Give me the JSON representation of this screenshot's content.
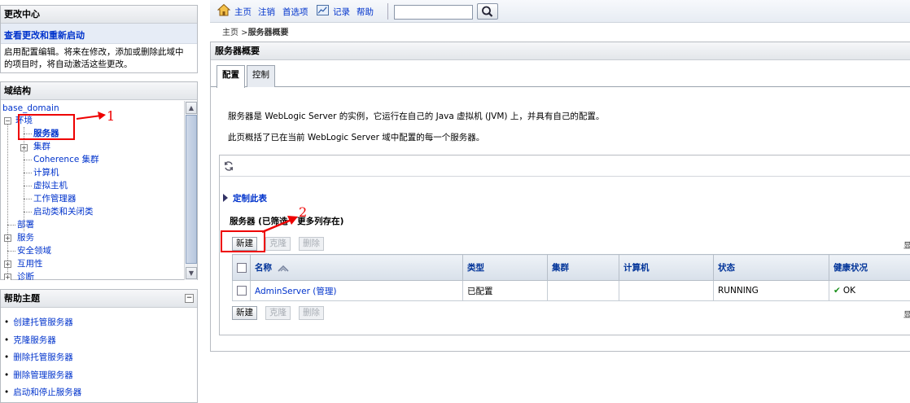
{
  "change_center": {
    "title": "更改中心",
    "link": "查看更改和重新启动",
    "desc_line1": "启用配置编辑。将来在修改，添加或删除此域中",
    "desc_line2": "的项目时，将自动激活这些更改。"
  },
  "domain_structure": {
    "title": "域结构",
    "root": "base_domain",
    "items": {
      "environment": "环境",
      "servers": "服务器",
      "clusters": "集群",
      "coherence": "Coherence 集群",
      "machines": "计算机",
      "virtual_hosts": "虚拟主机",
      "work_managers": "工作管理器",
      "startup_shutdown": "启动类和关闭类",
      "deployments": "部署",
      "services": "服务",
      "security_realms": "安全领域",
      "interoperability": "互用性",
      "diagnostics": "诊断"
    }
  },
  "help_topics": {
    "title": "帮助主题",
    "items": [
      "创建托管服务器",
      "克隆服务器",
      "删除托管服务器",
      "删除管理服务器",
      "启动和停止服务器"
    ]
  },
  "toolbar": {
    "home": "主页",
    "logout": "注销",
    "preferences": "首选项",
    "record": "记录",
    "help": "帮助",
    "search_value": ""
  },
  "breadcrumb": {
    "home": "主页",
    "sep": " >",
    "current": "服务器概要"
  },
  "panel": {
    "title": "服务器概要",
    "tabs": [
      "配置",
      "控制"
    ],
    "desc1": "服务器是 WebLogic Server 的实例，它运行在自己的 Java 虚拟机 (JVM) 上，并具有自己的配置。",
    "desc2": "此页概括了已在当前 WebLogic Server 域中配置的每一个服务器。",
    "customize": "定制此表",
    "table_caption": "服务器 (已筛选 - 更多列存在)",
    "buttons": {
      "new": "新建",
      "clone": "克隆",
      "delete": "删除"
    },
    "right_cut": "显",
    "columns": [
      "名称",
      "类型",
      "集群",
      "计算机",
      "状态",
      "健康状况"
    ],
    "rows": [
      {
        "name": "AdminServer (管理)",
        "type": "已配置",
        "cluster": "",
        "machine": "",
        "state": "RUNNING",
        "health": "OK"
      }
    ]
  },
  "annotations": {
    "one": "1",
    "two": "2"
  },
  "colors": {
    "annotation": "#e00000",
    "link": "#0033cc",
    "ok": "#1a8f1a"
  }
}
